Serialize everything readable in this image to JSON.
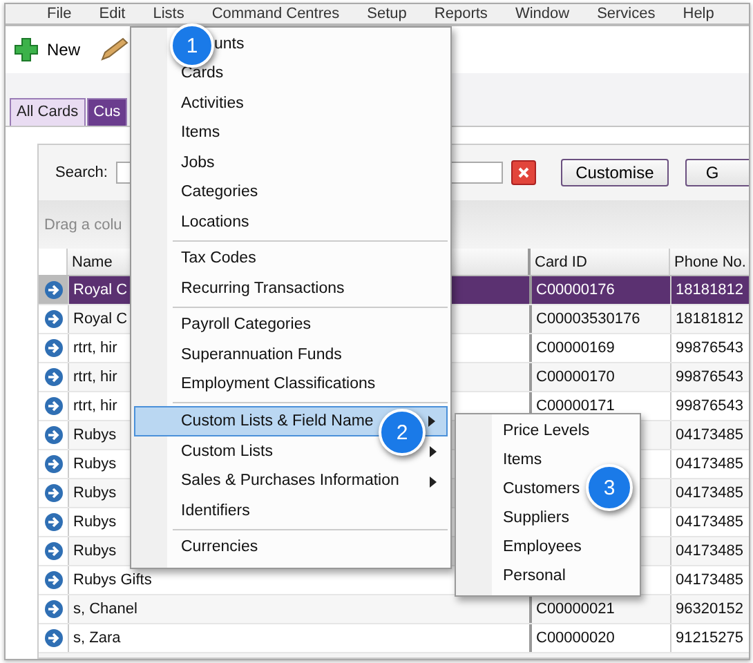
{
  "menubar": [
    {
      "label": "File"
    },
    {
      "label": "Edit"
    },
    {
      "label": "Lists"
    },
    {
      "label": "Command Centres"
    },
    {
      "label": "Setup"
    },
    {
      "label": "Reports"
    },
    {
      "label": "Window"
    },
    {
      "label": "Services"
    },
    {
      "label": "Help"
    }
  ],
  "toolbar": [
    {
      "kind": "new",
      "label": "New"
    },
    {
      "kind": "edit"
    }
  ],
  "tabs": [
    {
      "label": "All Cards",
      "selected": false
    },
    {
      "label": "Cus",
      "selected": true
    }
  ],
  "search": {
    "label": "Search:"
  },
  "buttons": [
    "Customise",
    "G"
  ],
  "group_panel": {
    "hint": "Drag a colu"
  },
  "table": {
    "columns": [
      "Name",
      "Card ID",
      "Phone No."
    ],
    "rows": [
      {
        "name": "Royal C",
        "card_id": "C00000176",
        "phone": "18181812",
        "selected": true
      },
      {
        "name": "Royal C",
        "card_id": "C00003530176",
        "phone": "18181812",
        "selected": false
      },
      {
        "name": "rtrt, hir",
        "card_id": "C00000169",
        "phone": "99876543",
        "selected": false
      },
      {
        "name": "rtrt, hir",
        "card_id": "C00000170",
        "phone": "99876543",
        "selected": false
      },
      {
        "name": "rtrt, hir",
        "card_id": "C00000171",
        "phone": "99876543",
        "selected": false
      },
      {
        "name": "Rubys",
        "phone": "04173485",
        "selected": false
      },
      {
        "name": "Rubys",
        "phone": "04173485",
        "selected": false
      },
      {
        "name": "Rubys",
        "phone": "04173485",
        "selected": false
      },
      {
        "name": "Rubys",
        "phone": "04173485",
        "selected": false
      },
      {
        "name": "Rubys",
        "phone": "04173485",
        "selected": false
      },
      {
        "name": "Rubys Gifts",
        "phone": "04173485",
        "selected": false
      },
      {
        "name": "s, Chanel",
        "card_id": "C00000021",
        "phone": "96320152",
        "selected": false
      },
      {
        "name": "s, Zara",
        "card_id": "C00000020",
        "phone": "91215275",
        "selected": false
      }
    ]
  },
  "menu": [
    {
      "kind": "item",
      "label": "unts",
      "highlighted": false,
      "submenu": false
    },
    {
      "kind": "item",
      "label": "Cards",
      "highlighted": false,
      "submenu": false
    },
    {
      "kind": "item",
      "label": "Activities",
      "highlighted": false,
      "submenu": false
    },
    {
      "kind": "item",
      "label": "Items",
      "highlighted": false,
      "submenu": false
    },
    {
      "kind": "item",
      "label": "Jobs",
      "highlighted": false,
      "submenu": false
    },
    {
      "kind": "item",
      "label": "Categories",
      "highlighted": false,
      "submenu": false
    },
    {
      "kind": "item",
      "label": "Locations",
      "highlighted": false,
      "submenu": false
    },
    {
      "kind": "separator"
    },
    {
      "kind": "item",
      "label": "Tax Codes",
      "highlighted": false,
      "submenu": false
    },
    {
      "kind": "item",
      "label": "Recurring Transactions",
      "highlighted": false,
      "submenu": false
    },
    {
      "kind": "separator"
    },
    {
      "kind": "item",
      "label": "Payroll Categories",
      "highlighted": false,
      "submenu": false
    },
    {
      "kind": "item",
      "label": "Superannuation Funds",
      "highlighted": false,
      "submenu": false
    },
    {
      "kind": "item",
      "label": "Employment Classifications",
      "highlighted": false,
      "submenu": false
    },
    {
      "kind": "separator"
    },
    {
      "kind": "item",
      "label": "Custom Lists & Field Name",
      "highlighted": true,
      "submenu": true
    },
    {
      "kind": "item",
      "label": "Custom Lists",
      "highlighted": false,
      "submenu": true
    },
    {
      "kind": "item",
      "label": "Sales & Purchases Information",
      "highlighted": false,
      "submenu": true
    },
    {
      "kind": "item",
      "label": "Identifiers",
      "highlighted": false,
      "submenu": false
    },
    {
      "kind": "separator"
    },
    {
      "kind": "item",
      "label": "Currencies",
      "highlighted": false,
      "submenu": false
    }
  ],
  "submenu": [
    {
      "label": "Price Levels"
    },
    {
      "label": "Items"
    },
    {
      "label": "Customers"
    },
    {
      "label": "Suppliers"
    },
    {
      "label": "Employees"
    },
    {
      "label": "Personal"
    }
  ],
  "callouts": [
    {
      "number": "1"
    },
    {
      "number": "2"
    },
    {
      "number": "3"
    }
  ]
}
